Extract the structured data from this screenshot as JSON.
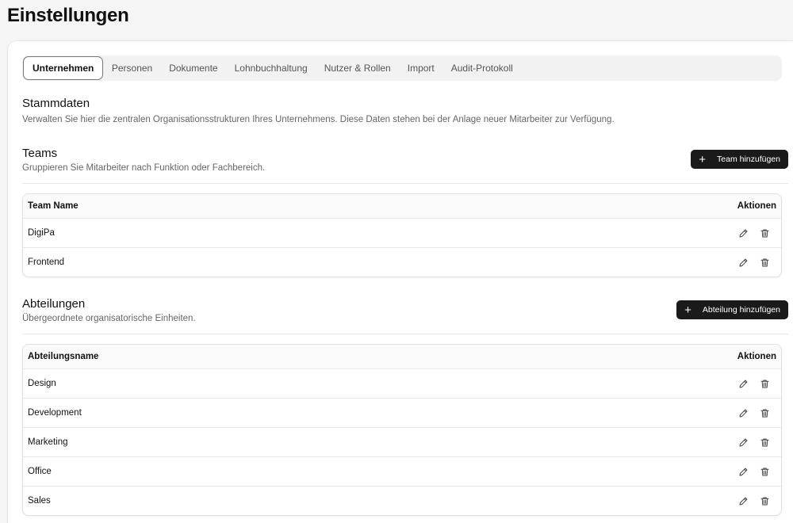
{
  "page": {
    "title": "Einstellungen"
  },
  "tabs": [
    {
      "label": "Unternehmen",
      "active": true
    },
    {
      "label": "Personen"
    },
    {
      "label": "Dokumente"
    },
    {
      "label": "Lohnbuchhaltung"
    },
    {
      "label": "Nutzer & Rollen"
    },
    {
      "label": "Import"
    },
    {
      "label": "Audit-Protokoll"
    }
  ],
  "stammdaten": {
    "title": "Stammdaten",
    "description": "Verwalten Sie hier die zentralen Organisationsstrukturen Ihres Unternehmens. Diese Daten stehen bei der Anlage neuer Mitarbeiter zur Verfügung."
  },
  "teams": {
    "title": "Teams",
    "description": "Gruppieren Sie Mitarbeiter nach Funktion oder Fachbereich.",
    "add_label": "Team hinzufügen",
    "col_name": "Team Name",
    "col_actions": "Aktionen",
    "rows": [
      "DigiPa",
      "Frontend"
    ]
  },
  "abteilungen": {
    "title": "Abteilungen",
    "description": "Übergeordnete organisatorische Einheiten.",
    "add_label": "Abteilung hinzufügen",
    "col_name": "Abteilungsname",
    "col_actions": "Aktionen",
    "rows": [
      "Design",
      "Development",
      "Marketing",
      "Office",
      "Sales"
    ]
  },
  "icons": {
    "add": "plus-icon",
    "edit": "pencil-icon",
    "delete": "trash-icon"
  },
  "colors": {
    "primary_button": "#1a1a1a",
    "background": "#f5f5f5"
  }
}
